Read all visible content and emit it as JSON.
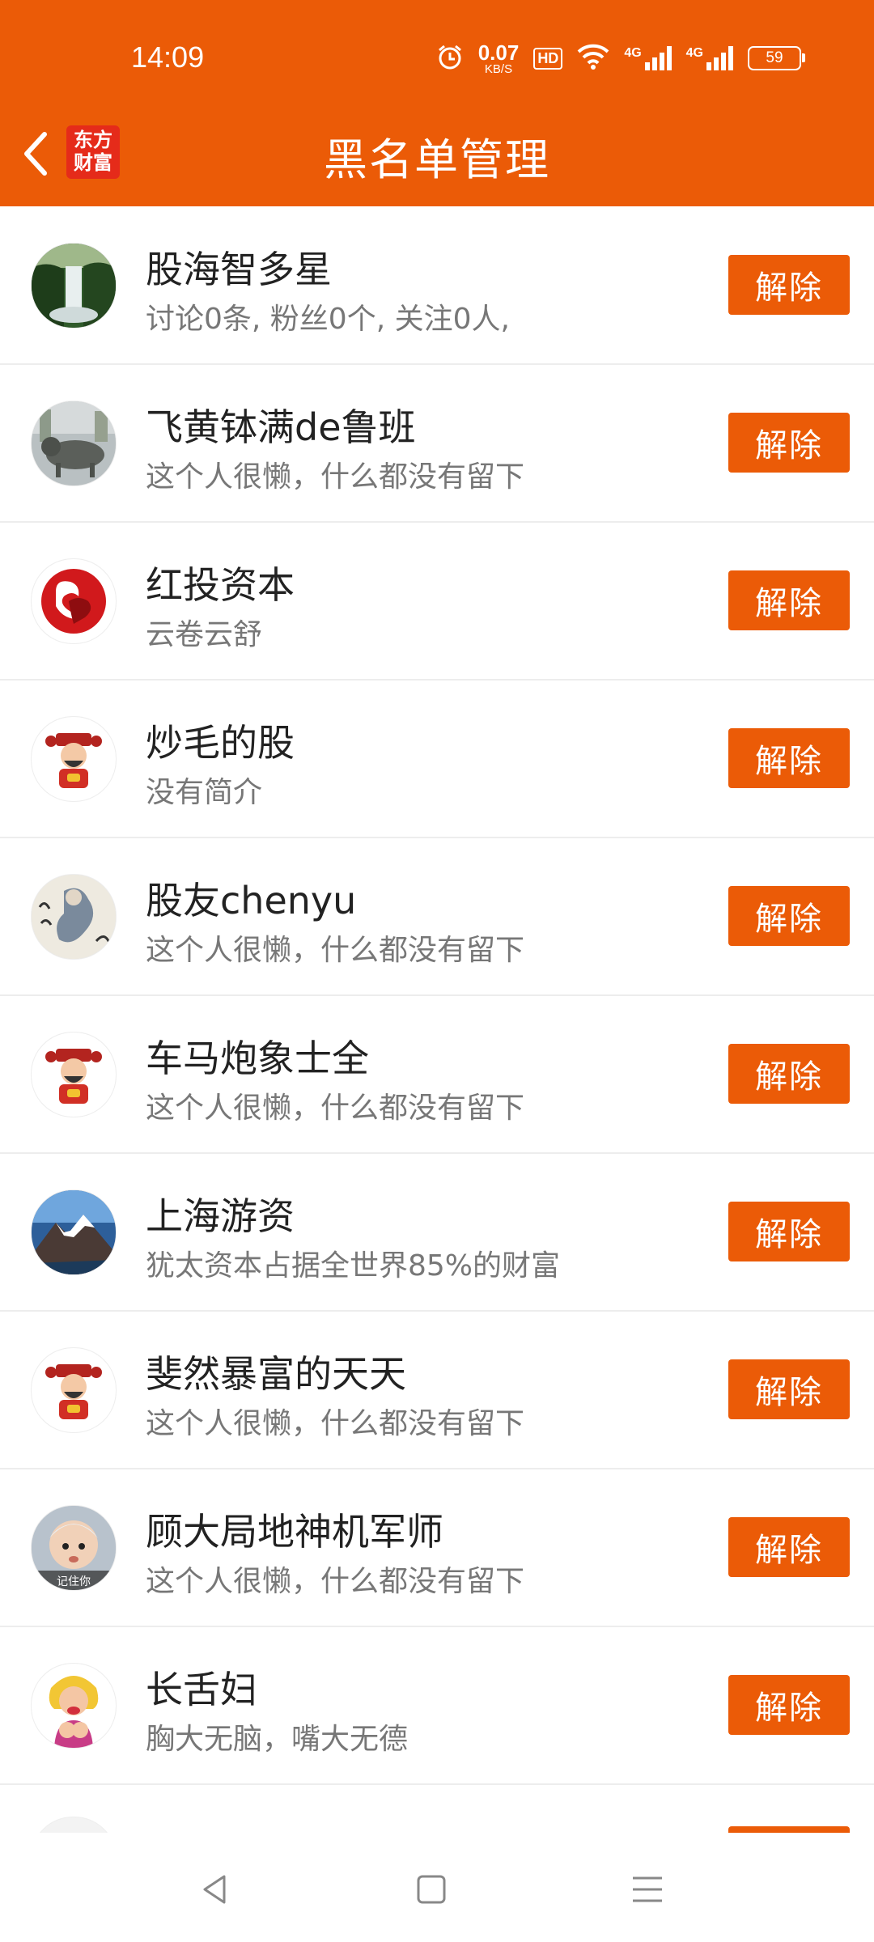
{
  "status_bar": {
    "time": "14:09",
    "speed_value": "0.07",
    "speed_unit": "KB/S",
    "hd_label": "HD",
    "net_label_1": "4G",
    "net_label_2": "4G",
    "battery": "59"
  },
  "header": {
    "title": "黑名单管理",
    "logo_line1": "东方",
    "logo_line2": "财富",
    "background_color": "#EB5B07"
  },
  "blocked_users": [
    {
      "name": "股海智多星",
      "desc": "讨论0条, 粉丝0个, 关注0人,",
      "button": "解除",
      "avatar": "waterfall"
    },
    {
      "name": "飞黄钵满de鲁班",
      "desc": "这个人很懒，什么都没有留下",
      "button": "解除",
      "avatar": "bull-statue"
    },
    {
      "name": "红投资本",
      "desc": "云卷云舒",
      "button": "解除",
      "avatar": "red-heart"
    },
    {
      "name": "炒毛的股",
      "desc": "没有简介",
      "button": "解除",
      "avatar": "fortune-god"
    },
    {
      "name": "股友chenyu",
      "desc": "这个人很懒，什么都没有留下",
      "button": "解除",
      "avatar": "ink-painting"
    },
    {
      "name": "车马炮象士全",
      "desc": "这个人很懒，什么都没有留下",
      "button": "解除",
      "avatar": "fortune-god"
    },
    {
      "name": "上海游资",
      "desc": "犹太资本占据全世界85%的财富",
      "button": "解除",
      "avatar": "snow-mountain"
    },
    {
      "name": "斐然暴富的天天",
      "desc": "这个人很懒，什么都没有留下",
      "button": "解除",
      "avatar": "fortune-god"
    },
    {
      "name": "顾大局地神机军师",
      "desc": "这个人很懒，什么都没有留下",
      "button": "解除",
      "avatar": "baby-photo"
    },
    {
      "name": "长舌妇",
      "desc": "胸大无脑，嘴大无德",
      "button": "解除",
      "avatar": "cartoon-lady"
    }
  ],
  "avatar_text": {
    "baby_caption": "记住你"
  },
  "accent_color": "#EB5B07"
}
